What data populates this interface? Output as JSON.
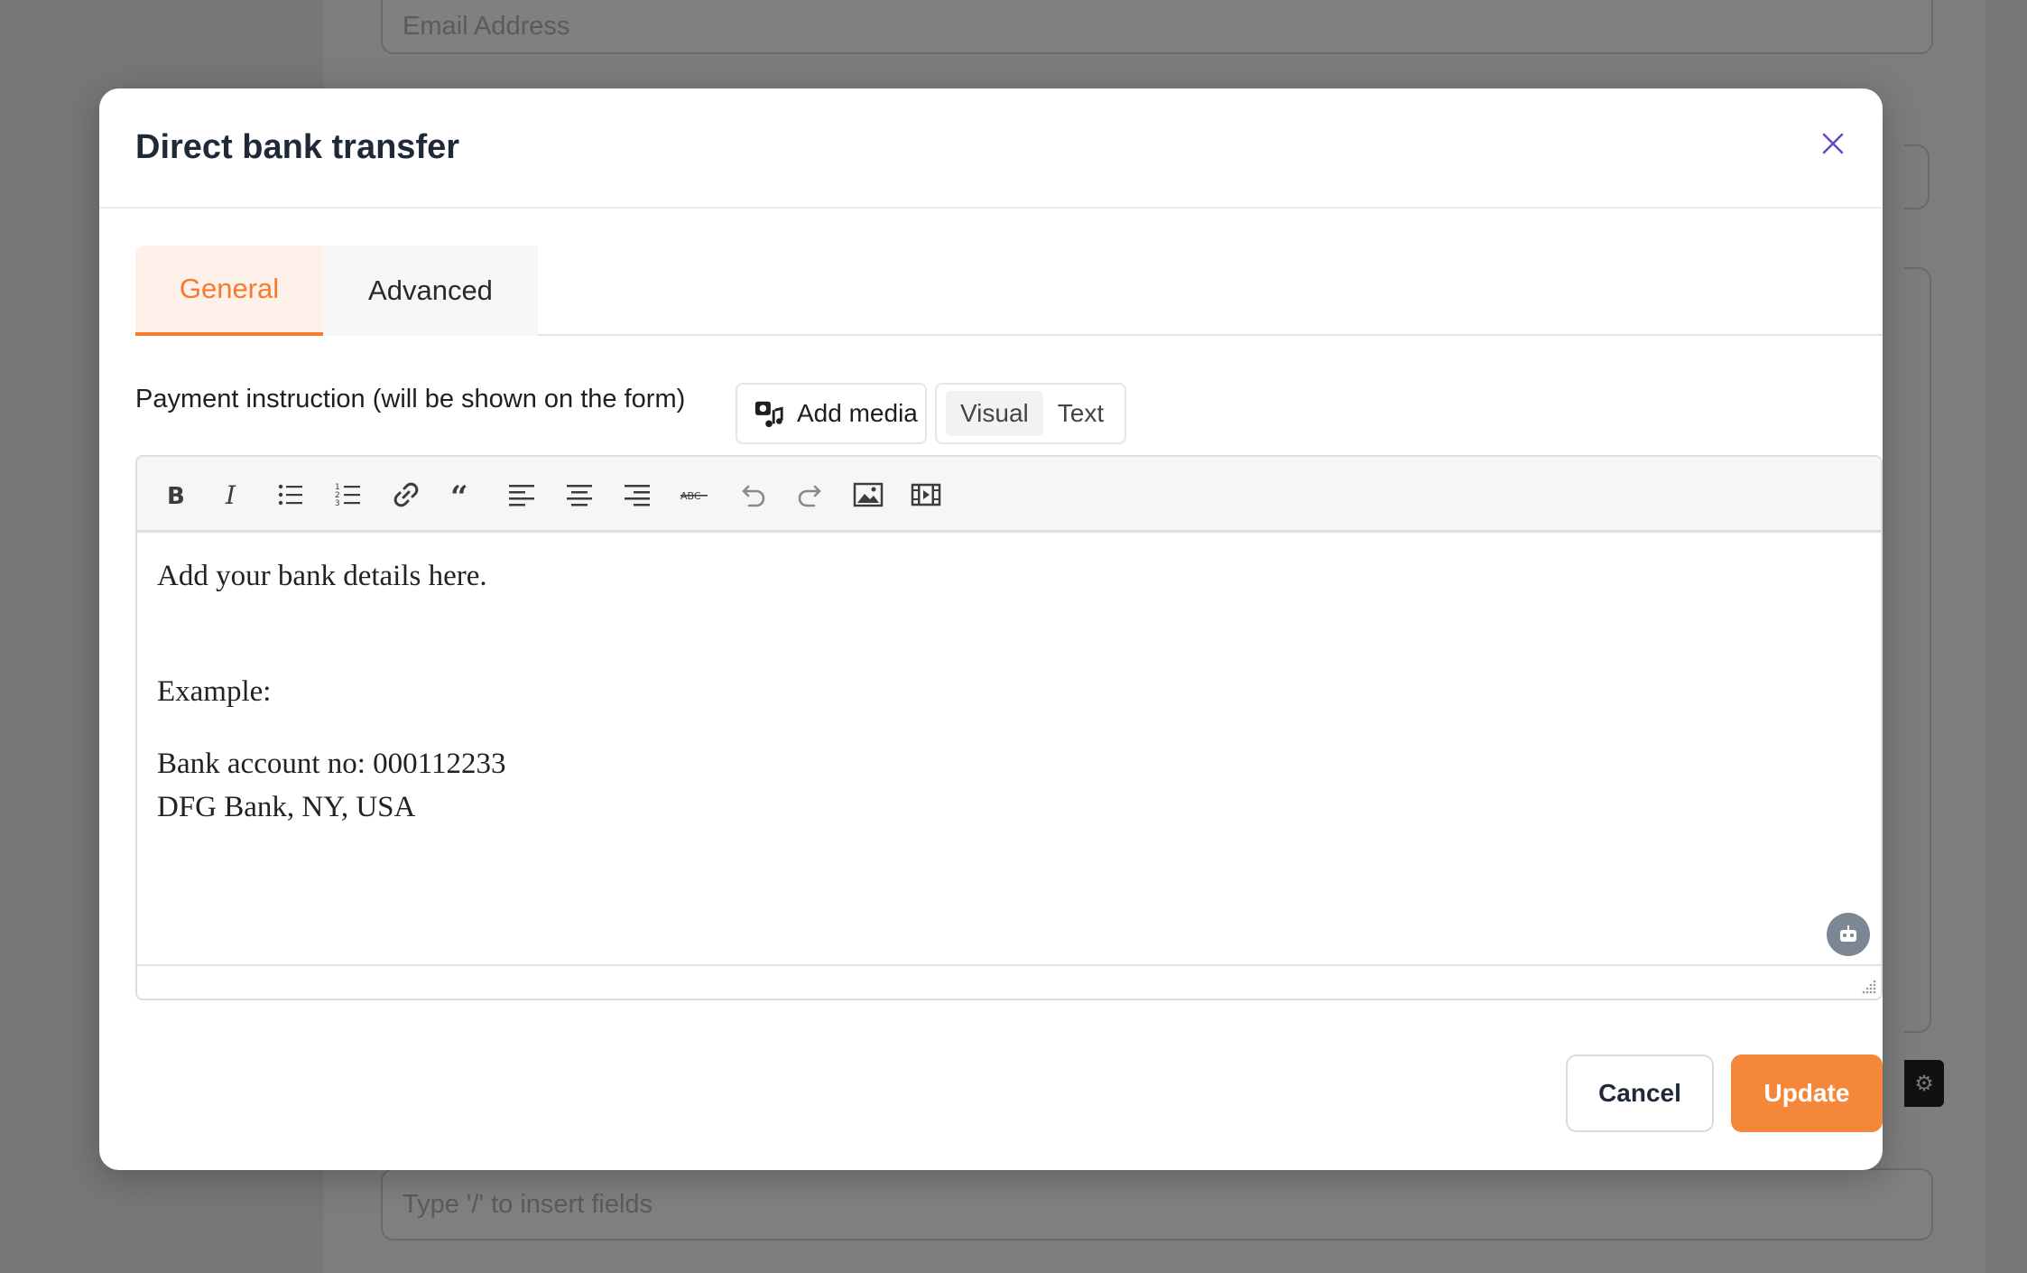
{
  "background": {
    "email_placeholder": "Email Address",
    "insert_fields_placeholder": "Type '/' to insert fields"
  },
  "modal": {
    "title": "Direct bank transfer",
    "close_icon": "close-icon",
    "accent_color": "#f47c2f",
    "tabs": [
      {
        "label": "General",
        "active": true
      },
      {
        "label": "Advanced",
        "active": false
      }
    ],
    "payment_instruction_label": "Payment instruction (will be shown on the form)",
    "add_media_label": "Add media",
    "editor_modes": [
      {
        "label": "Visual",
        "active": true
      },
      {
        "label": "Text",
        "active": false
      }
    ],
    "toolbar": [
      "bold-icon",
      "italic-icon",
      "bullet-list-icon",
      "numbered-list-icon",
      "link-icon",
      "blockquote-icon",
      "align-left-icon",
      "align-center-icon",
      "align-right-icon",
      "strikethrough-icon",
      "undo-icon",
      "redo-icon",
      "image-icon",
      "video-icon"
    ],
    "content": {
      "line1": "Add your bank details here.",
      "line2": "Example:",
      "line3": "Bank account no: 000112233",
      "line4": "DFG Bank, NY, USA"
    },
    "buttons": {
      "cancel": "Cancel",
      "update": "Update"
    }
  }
}
